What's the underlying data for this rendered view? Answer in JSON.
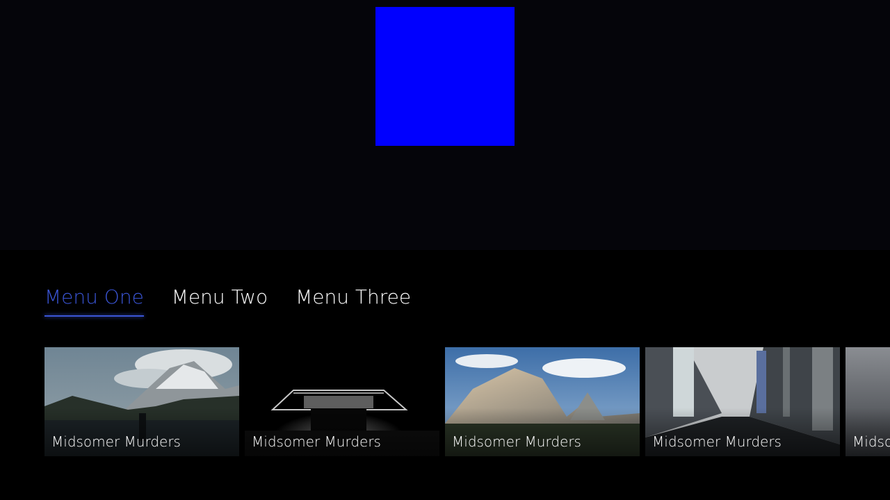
{
  "hero": {
    "accent_color": "#0000ff"
  },
  "menu": {
    "active_color": "#3a55d6",
    "items": [
      {
        "label": "Menu One",
        "active": true
      },
      {
        "label": "Menu Two",
        "active": false
      },
      {
        "label": "Menu Three",
        "active": false
      }
    ]
  },
  "rail": {
    "cards": [
      {
        "title": "Midsomer Murders",
        "art": "misty-mountain-lake"
      },
      {
        "title": "Midsomer Murders",
        "art": "dark-bridge-underpass"
      },
      {
        "title": "Midsomer Murders",
        "art": "granite-mountain-sky"
      },
      {
        "title": "Midsomer Murders",
        "art": "city-street-buildings"
      },
      {
        "title": "Midsomer Murders",
        "art": "grey-foggy-scene"
      }
    ]
  }
}
